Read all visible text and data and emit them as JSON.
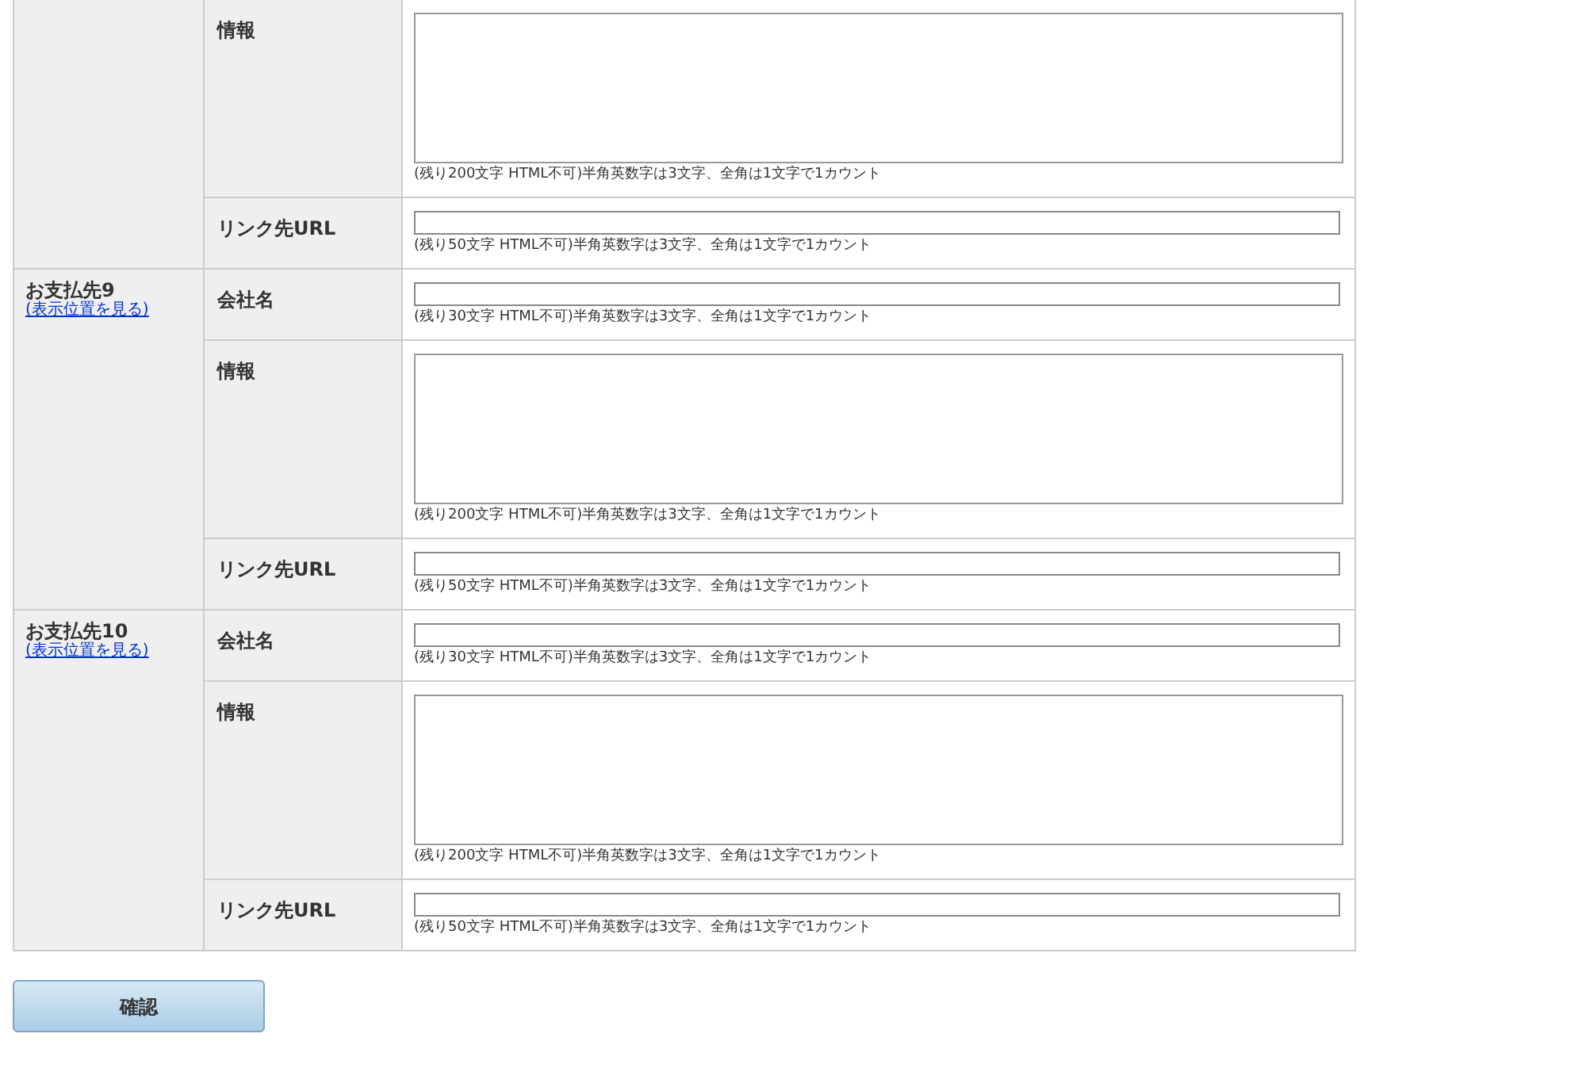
{
  "groups": [
    {
      "rows": [
        {
          "kind": "textarea",
          "label": "情報",
          "hint": "(残り200文字 HTML不可)半角英数字は3文字、全角は1文字で1カウント"
        },
        {
          "kind": "input",
          "label": "リンク先URL",
          "hint": "(残り50文字 HTML不可)半角英数字は3文字、全角は1文字で1カウント"
        }
      ]
    },
    {
      "name": "お支払先9",
      "link": "(表示位置を見る)",
      "rows": [
        {
          "kind": "input",
          "label": "会社名",
          "hint": "(残り30文字 HTML不可)半角英数字は3文字、全角は1文字で1カウント"
        },
        {
          "kind": "textarea",
          "label": "情報",
          "hint": "(残り200文字 HTML不可)半角英数字は3文字、全角は1文字で1カウント"
        },
        {
          "kind": "input",
          "label": "リンク先URL",
          "hint": "(残り50文字 HTML不可)半角英数字は3文字、全角は1文字で1カウント"
        }
      ]
    },
    {
      "name": "お支払先10",
      "link": "(表示位置を見る)",
      "rows": [
        {
          "kind": "input",
          "label": "会社名",
          "hint": "(残り30文字 HTML不可)半角英数字は3文字、全角は1文字で1カウント"
        },
        {
          "kind": "textarea",
          "label": "情報",
          "hint": "(残り200文字 HTML不可)半角英数字は3文字、全角は1文字で1カウント"
        },
        {
          "kind": "input",
          "label": "リンク先URL",
          "hint": "(残り50文字 HTML不可)半角英数字は3文字、全角は1文字で1カウント"
        }
      ]
    }
  ],
  "submit": "確認"
}
